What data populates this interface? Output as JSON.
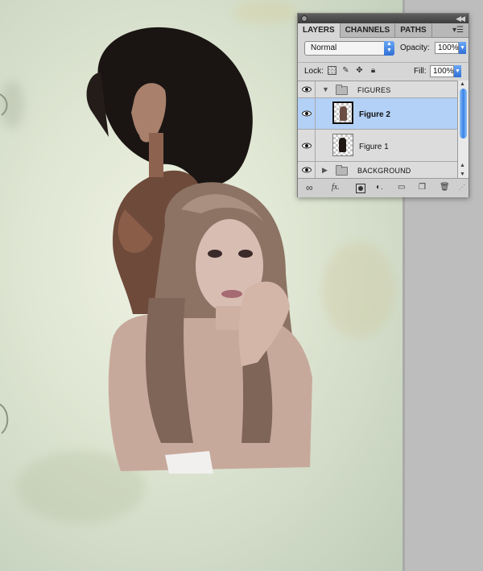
{
  "panel": {
    "tabs": [
      "LAYERS",
      "CHANNELS",
      "PATHS"
    ],
    "blend_mode": "Normal",
    "opacity_label": "Opacity:",
    "opacity_value": "100%",
    "lock_label": "Lock:",
    "fill_label": "Fill:",
    "fill_value": "100%",
    "layers": [
      {
        "type": "group",
        "label": "FIGURES",
        "expanded": true
      },
      {
        "type": "layer",
        "label": "Figure 2",
        "selected": true
      },
      {
        "type": "layer",
        "label": "Figure 1",
        "selected": false
      },
      {
        "type": "group",
        "label": "BACKGROUND",
        "expanded": false
      }
    ]
  },
  "colors": {
    "selection": "#b3d1f7",
    "accent": "#3a82e6"
  }
}
